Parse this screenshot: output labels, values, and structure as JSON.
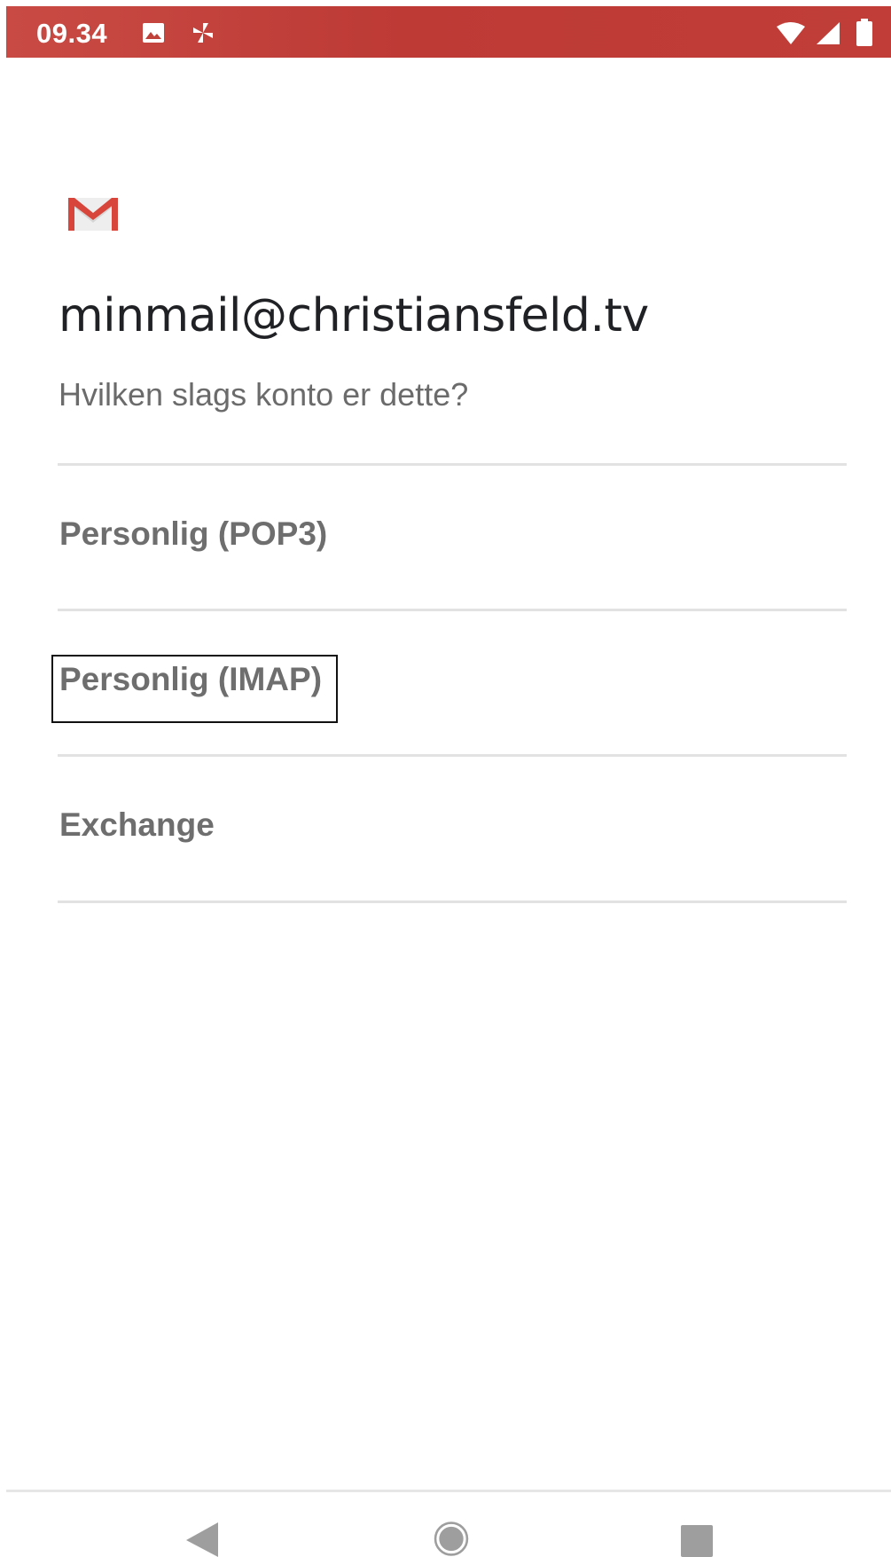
{
  "status_bar": {
    "time": "09.34",
    "icons": [
      "image-icon",
      "pinwheel-icon",
      "wifi-icon",
      "signal-icon",
      "battery-icon"
    ],
    "background_color": "#c0403a"
  },
  "app": {
    "logo": "gmail-logo",
    "account_email": "minmail@christiansfeld.tv",
    "question": "Hvilken slags konto er dette?"
  },
  "account_types": [
    {
      "label": "Personlig (POP3)"
    },
    {
      "label": "Personlig (IMAP)",
      "focused": true
    },
    {
      "label": "Exchange"
    }
  ],
  "nav_bar": {
    "buttons": [
      "back-button",
      "home-button",
      "recents-button"
    ]
  }
}
